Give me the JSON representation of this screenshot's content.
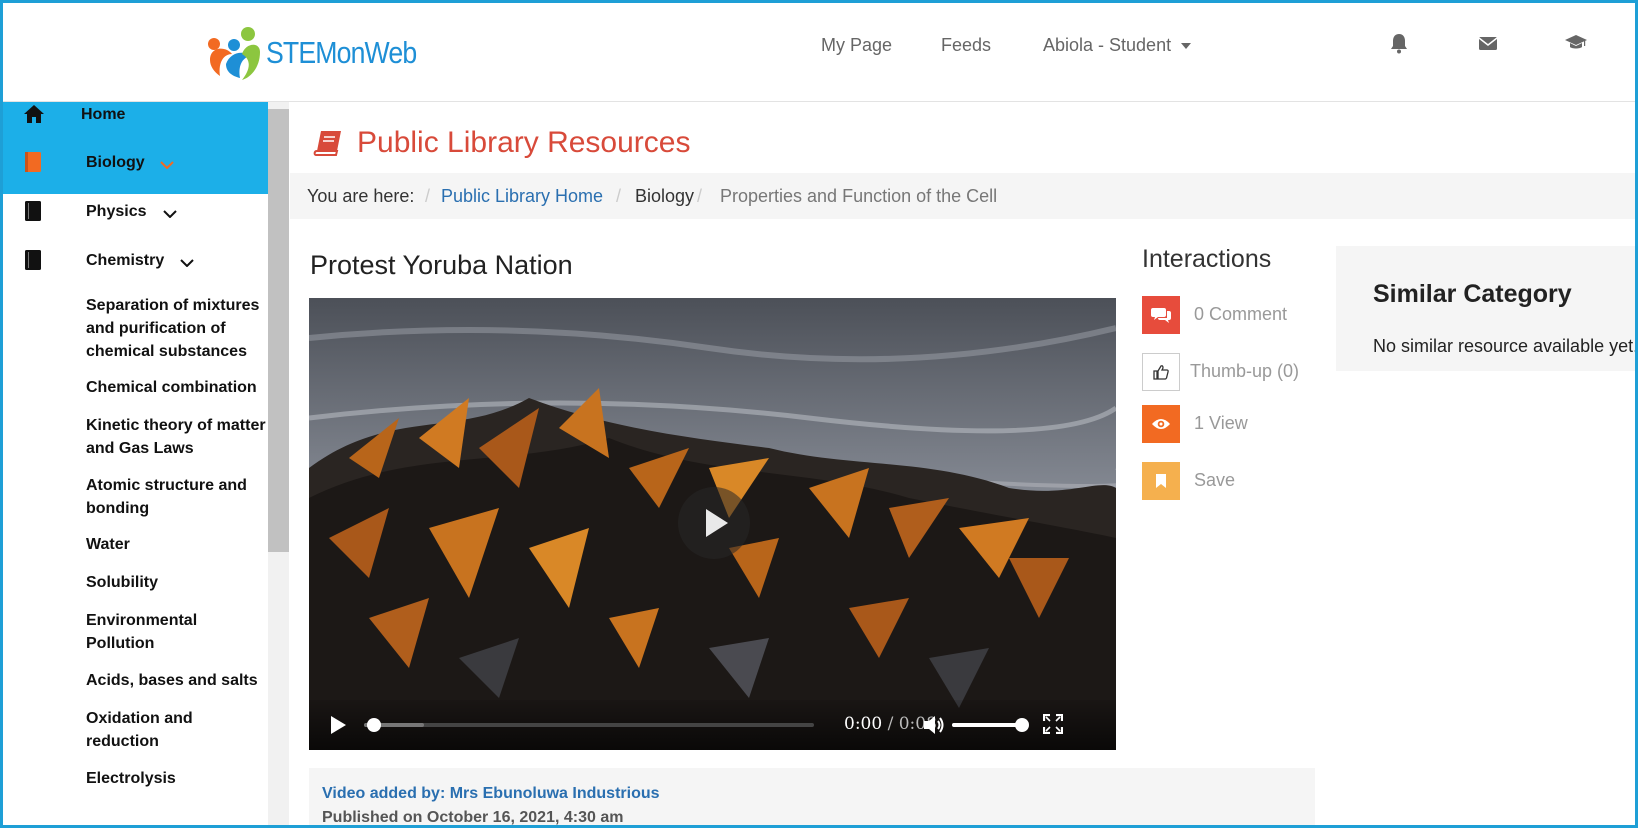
{
  "header": {
    "logo_text": "STEMonWeb",
    "nav": [
      "My Page",
      "Feeds",
      "Abiola - Student"
    ],
    "icons": [
      "bell-icon",
      "envelope-icon",
      "graduation-cap-icon"
    ]
  },
  "sidebar": {
    "items": [
      {
        "label": "Home",
        "icon": "home-icon"
      },
      {
        "label": "Biology",
        "icon": "book-icon"
      },
      {
        "label": "Physics",
        "icon": "book-icon"
      },
      {
        "label": "Chemistry",
        "icon": "book-icon"
      }
    ],
    "chemistry_topics": [
      "Separation of mixtures and purification of chemical substances",
      "Chemical combination",
      "Kinetic theory of matter and Gas Laws",
      "Atomic structure and bonding",
      "Water",
      "Solubility",
      "Environmental Pollution",
      "Acids, bases and salts",
      "Oxidation and reduction",
      "Electrolysis"
    ]
  },
  "page": {
    "title": "Public Library Resources",
    "breadcrumb": {
      "prefix": "You are here:",
      "items": [
        "Public Library Home",
        "Biology",
        "Properties and Function of the Cell"
      ]
    }
  },
  "resource": {
    "title": "Protest Yoruba Nation",
    "video": {
      "current_time": "0:00",
      "duration": "/ 0:08",
      "progress_fraction": 0.0,
      "volume_fraction": 1.0
    },
    "added_by": "Video added by: Mrs Ebunoluwa Industrious",
    "published": "Published on October 16, 2021, 4:30 am"
  },
  "interactions": {
    "title": "Interactions",
    "items": [
      {
        "label": "0 Comment",
        "icon": "comments-icon",
        "color": "#e74c3c"
      },
      {
        "label": "Thumb-up (0)",
        "icon": "thumbs-up-icon",
        "color": "#ffffff"
      },
      {
        "label": "1 View",
        "icon": "eye-icon",
        "color": "#f26a22"
      },
      {
        "label": "Save",
        "icon": "bookmark-icon",
        "color": "#f5b04e"
      }
    ]
  },
  "similar": {
    "title": "Similar Category",
    "text": "No similar resource available yet."
  },
  "colors": {
    "accent": "#1cafe8",
    "title_red": "#d84a3a",
    "link_blue": "#2a6fb0"
  }
}
